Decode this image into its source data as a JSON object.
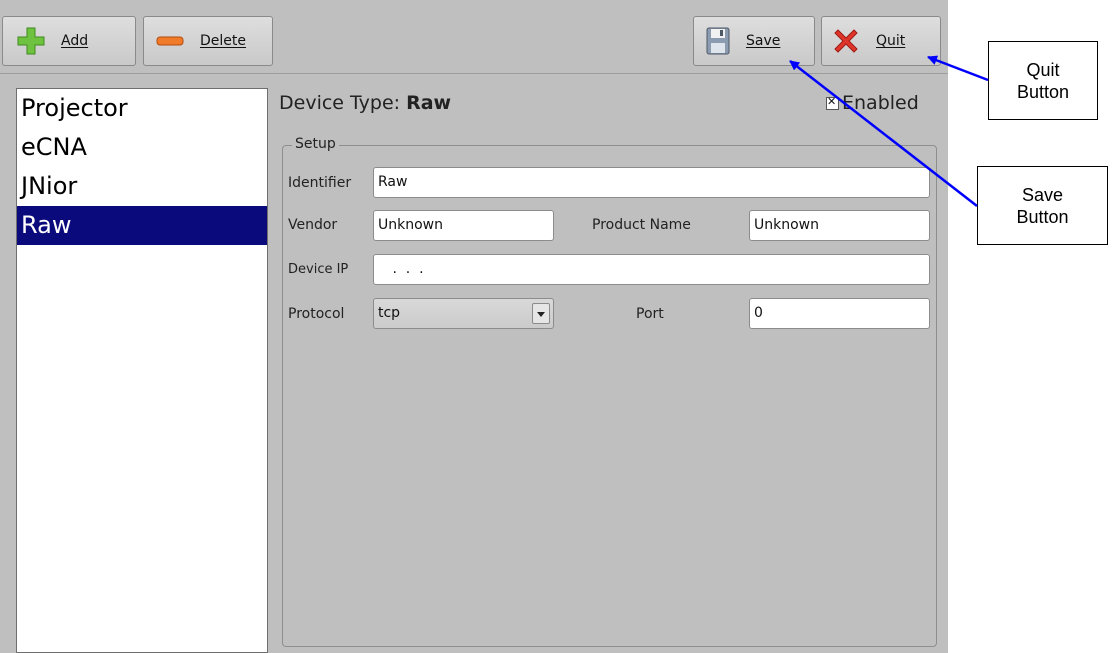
{
  "toolbar": {
    "add_label": "Add",
    "delete_label": "Delete",
    "save_label": "Save",
    "quit_label": "Quit"
  },
  "devices": [
    {
      "label": "Projector",
      "selected": false
    },
    {
      "label": "eCNA",
      "selected": false
    },
    {
      "label": "JNior",
      "selected": false
    },
    {
      "label": "Raw",
      "selected": true
    }
  ],
  "detail": {
    "device_type_prefix": "Device Type: ",
    "device_type_value": "Raw",
    "enabled_label": "Enabled",
    "enabled_checked": true
  },
  "setup": {
    "group_title": "Setup",
    "identifier_label": "Identifier",
    "identifier_value": "Raw",
    "vendor_label": "Vendor",
    "vendor_value": "Unknown",
    "product_name_label": "Product Name",
    "product_name_value": "Unknown",
    "device_ip_label": "Device IP",
    "device_ip_value": " .  .  .",
    "protocol_label": "Protocol",
    "protocol_value": "tcp",
    "port_label": "Port",
    "port_value": "0"
  },
  "annotations": {
    "quit_line1": "Quit",
    "quit_line2": "Button",
    "save_line1": "Save",
    "save_line2": "Button"
  },
  "colors": {
    "window_bg": "#bfbfbf",
    "selection": "#0b0a7d",
    "arrow": "#0000ff"
  },
  "icons": {
    "add": "plus-icon",
    "delete": "minus-icon",
    "save": "floppy-disk-icon",
    "quit": "red-x-icon",
    "dropdown": "chevron-down-icon"
  }
}
